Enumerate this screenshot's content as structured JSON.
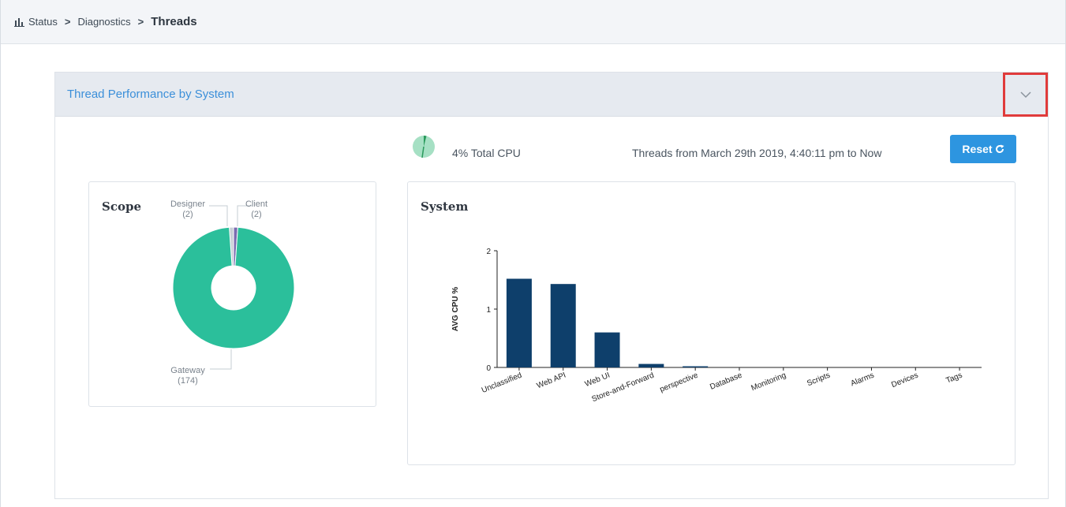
{
  "breadcrumb": {
    "items": [
      "Status",
      "Diagnostics"
    ],
    "current": "Threads",
    "separator": ">"
  },
  "panel": {
    "title": "Thread Performance by System",
    "collapse_icon": "chevron-down-icon"
  },
  "cpu": {
    "label": "4% Total CPU",
    "percent": 4
  },
  "threads_range": "Threads from March 29th 2019, 4:40:11 pm to Now",
  "reset_label": "Reset",
  "scope": {
    "title": "Scope",
    "designer_label": "Designer",
    "designer_count": "(2)",
    "client_label": "Client",
    "client_count": "(2)",
    "gateway_label": "Gateway",
    "gateway_count": "(174)"
  },
  "system": {
    "title": "System"
  },
  "colors": {
    "accent": "#2d95e0",
    "donut_main": "#2bbf9b",
    "bar": "#0e3f6b",
    "highlight_border": "#e03b3b"
  },
  "chart_data": [
    {
      "type": "pie",
      "title": "Scope",
      "categories": [
        "Gateway",
        "Designer",
        "Client"
      ],
      "values": [
        174,
        2,
        2
      ]
    },
    {
      "type": "bar",
      "title": "System",
      "ylabel": "AVG CPU %",
      "xlabel": "",
      "ylim": [
        0,
        2
      ],
      "yticks": [
        "0",
        "1",
        "2"
      ],
      "categories": [
        "Unclassified",
        "Web API",
        "Web UI",
        "Store-and-Forward",
        "perspective",
        "Database",
        "Monitoring",
        "Scripts",
        "Alarms",
        "Devices",
        "Tags"
      ],
      "values": [
        1.52,
        1.43,
        0.6,
        0.06,
        0.02,
        0,
        0,
        0,
        0,
        0,
        0
      ]
    }
  ]
}
